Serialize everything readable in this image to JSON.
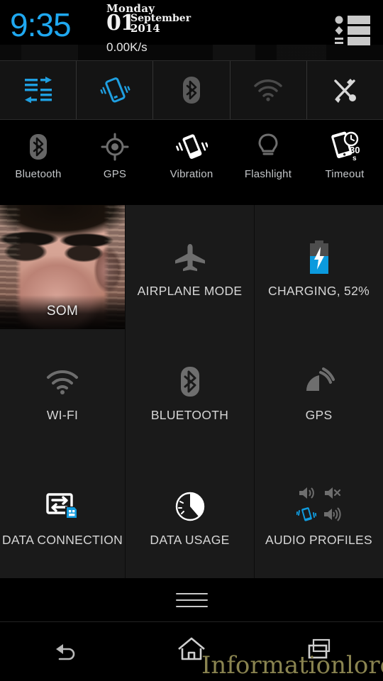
{
  "statusbar": {
    "clock": "9:35",
    "day_name": "Monday",
    "day_number": "01",
    "month": "September",
    "year": "2014",
    "network_speed": "0.00K/s",
    "menu_icon": "list-menu-icon"
  },
  "toggle_strip": {
    "items": [
      {
        "name": "sliders-icon",
        "label": "Sliders",
        "active": true,
        "color": "#1f9fe0"
      },
      {
        "name": "vibration-icon",
        "label": "Vibration",
        "active": true,
        "color": "#1f9fe0"
      },
      {
        "name": "bluetooth-icon",
        "label": "Bluetooth",
        "active": false,
        "color": "#555555"
      },
      {
        "name": "wifi-icon",
        "label": "Wi-Fi",
        "active": false,
        "color": "#4a4a4a"
      },
      {
        "name": "tools-icon",
        "label": "Tools",
        "active": false,
        "color": "#d8d8d8"
      }
    ]
  },
  "quick_toggles": {
    "items": [
      {
        "label": "Bluetooth",
        "icon": "bluetooth-icon",
        "state": "off"
      },
      {
        "label": "GPS",
        "icon": "gps-icon",
        "state": "off"
      },
      {
        "label": "Vibration",
        "icon": "vibration-icon",
        "state": "on"
      },
      {
        "label": "Flashlight",
        "icon": "flashlight-icon",
        "state": "off"
      },
      {
        "label": "Timeout",
        "icon": "screen-timeout-icon",
        "state": "on",
        "value": "30",
        "unit": "s"
      }
    ]
  },
  "tiles": {
    "profile": {
      "label": "SOM",
      "icon": "profile-photo"
    },
    "airplane": {
      "label": "AIRPLANE MODE",
      "icon": "airplane-icon",
      "state": "off"
    },
    "battery": {
      "label": "CHARGING, 52%",
      "icon": "battery-charging-icon",
      "percent": 52,
      "state": "charging"
    },
    "wifi": {
      "label": "WI-FI",
      "icon": "wifi-icon",
      "state": "off"
    },
    "bluetooth": {
      "label": "BLUETOOTH",
      "icon": "bluetooth-icon",
      "state": "off"
    },
    "gps": {
      "label": "GPS",
      "icon": "gps-satellite-icon",
      "state": "off"
    },
    "data_conn": {
      "label": "DATA CONNECTION",
      "icon": "data-connection-icon",
      "state": "on"
    },
    "data_usage": {
      "label": "DATA USAGE",
      "icon": "data-usage-pie-icon",
      "state": "on"
    },
    "audio": {
      "label": "AUDIO PROFILES",
      "icons": [
        "volume-on-icon",
        "volume-mute-icon",
        "vibrate-icon",
        "volume-loud-icon"
      ],
      "selected": "vibrate-icon"
    }
  },
  "drag_handle": {
    "name": "drag-handle"
  },
  "navbar": {
    "back": "back-icon",
    "home": "home-icon",
    "recents": "recents-icon"
  },
  "watermark": {
    "text": "Informationlord",
    "color": "#8a8450"
  },
  "colors": {
    "accent_blue": "#1f9fe0",
    "clock_blue": "#1fa8f0",
    "tile_bg": "#1a1a1a",
    "page_bg": "#000000",
    "label_gray": "#d6d6d6",
    "icon_gray": "#5a5a5a"
  }
}
